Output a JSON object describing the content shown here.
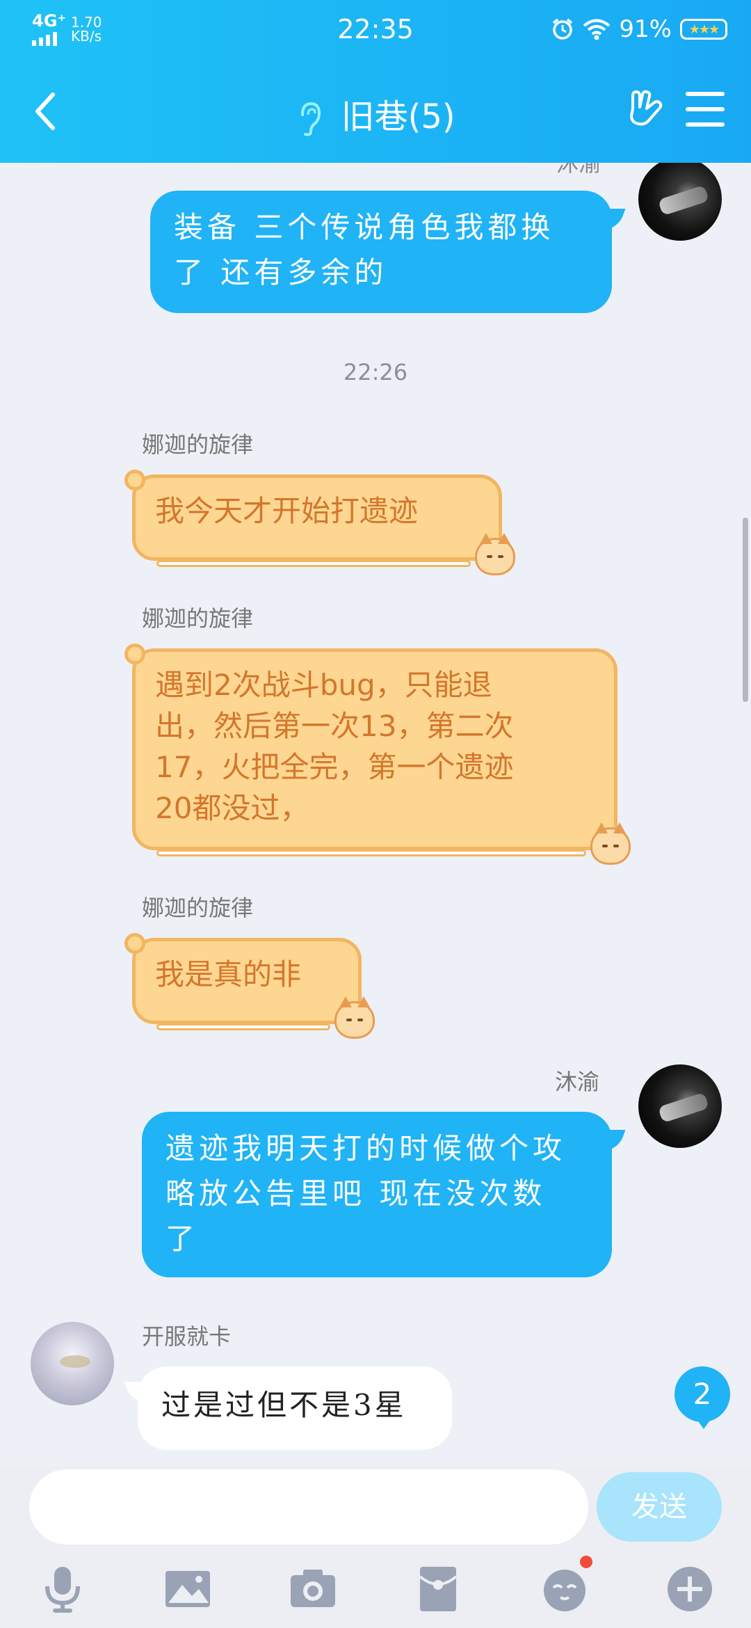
{
  "status_bar": {
    "network": "4G⁺",
    "speed_value": "1.70",
    "speed_unit": "KB/s",
    "time": "22:35",
    "battery": "91%",
    "battery_icon_text": "★★★"
  },
  "header": {
    "title": "旧巷(5)"
  },
  "messages": [
    {
      "id": "m0",
      "sender": "沐渝",
      "text_line1": "装备  三个传说角色我都换",
      "text_line2": "了  还有多余的"
    },
    {
      "id": "ts",
      "text": "22:26"
    },
    {
      "id": "m1",
      "sender": "娜迦的旋律",
      "text": "我今天才开始打遗迹"
    },
    {
      "id": "m2",
      "sender": "娜迦的旋律",
      "lines": [
        "遇到2次战斗bug，只能退",
        "出，然后第一次13，第二次",
        "17，火把全完，第一个遗迹",
        "20都没过，"
      ]
    },
    {
      "id": "m3",
      "sender": "娜迦的旋律",
      "text": "我是真的非"
    },
    {
      "id": "m4",
      "sender": "沐渝",
      "lines": [
        "遗迹我明天打的时候做个攻",
        "略放公告里吧 现在没次数",
        "了"
      ]
    },
    {
      "id": "m5",
      "sender": "开服就卡",
      "text": "过是过但不是3星"
    }
  ],
  "new_message_badge": "2",
  "input": {
    "value": "",
    "send_label": "发送"
  },
  "toolbar_icons": [
    "microphone-icon",
    "image-icon",
    "camera-icon",
    "red-packet-icon",
    "emoji-icon",
    "plus-icon"
  ],
  "colors": {
    "header_start": "#1fc2f6",
    "header_end": "#19a9f4",
    "own_bubble": "#20b3f6",
    "cat_bubble_fill": "#fdd792",
    "cat_bubble_text": "#d4762c",
    "send_button": "#a8e4fb",
    "notification_dot": "#f14c3a"
  }
}
